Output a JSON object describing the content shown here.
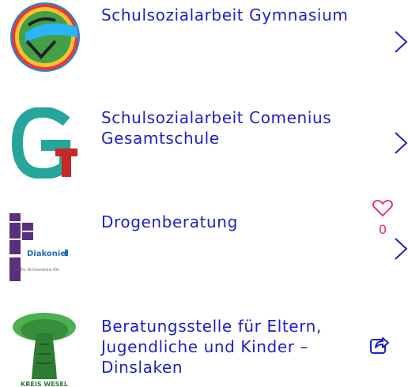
{
  "items": [
    {
      "title_lines": [
        "Schulsozialarbeit Gymnasium"
      ],
      "logo": "gymnasium-logo",
      "action": "chevron-right-icon"
    },
    {
      "title_lines": [
        "Schulsozialarbeit Comenius",
        "Gesamtschule"
      ],
      "logo": "comenius-logo",
      "action": "chevron-right-icon"
    },
    {
      "title_lines": [
        "Drogenberatung"
      ],
      "logo": "diakonie-logo",
      "logo_text": "Diakonie",
      "logo_subtext": "im Ev. Kirchenkreis Din",
      "like_count": "0",
      "action": "chevron-right-icon"
    },
    {
      "title_lines": [
        "Beratungsstelle für Eltern,",
        "Jugendliche und Kinder –",
        "Dinslaken"
      ],
      "logo": "tree-logo",
      "logo_text": "KREIS WESEL",
      "action": "share-icon"
    }
  ],
  "colors": {
    "title": "#1a1fcf",
    "chevron": "#1a1fcf",
    "heart": "#e8207a",
    "diakonie_purple": "#5b2e7e",
    "tree_green": "#2e7d32"
  }
}
